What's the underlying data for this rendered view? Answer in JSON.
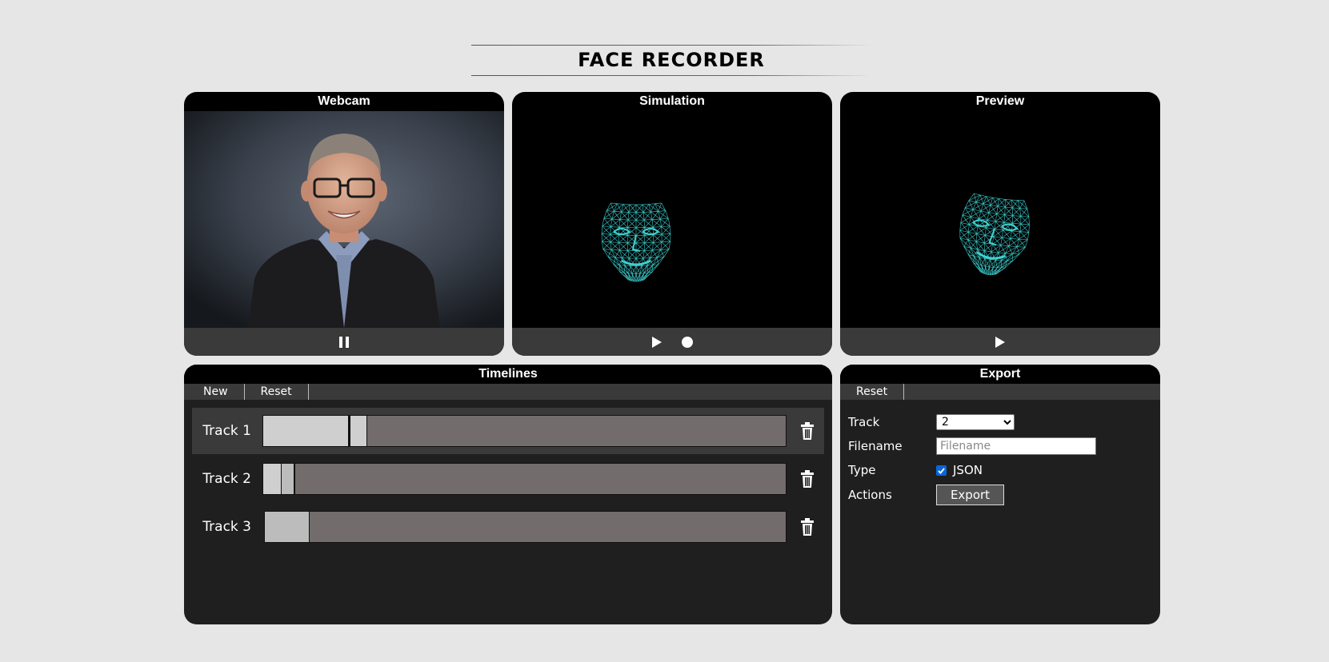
{
  "app": {
    "title": "FACE RECORDER"
  },
  "panels": {
    "webcam": {
      "title": "Webcam"
    },
    "simulation": {
      "title": "Simulation"
    },
    "preview": {
      "title": "Preview"
    }
  },
  "icons": {
    "pause": "pause-icon",
    "play": "play-icon",
    "record": "record-icon",
    "trash": "trash-icon"
  },
  "timelines": {
    "title": "Timelines",
    "toolbar": {
      "new_label": "New",
      "reset_label": "Reset"
    },
    "tracks": [
      {
        "label": "Track 1",
        "selected": true
      },
      {
        "label": "Track 2",
        "selected": false
      },
      {
        "label": "Track 3",
        "selected": false
      }
    ]
  },
  "export": {
    "title": "Export",
    "toolbar": {
      "reset_label": "Reset"
    },
    "track_label": "Track",
    "track_value": "2",
    "filename_label": "Filename",
    "filename_placeholder": "Filename",
    "type_label": "Type",
    "type_option": "JSON",
    "type_checked": true,
    "actions_label": "Actions",
    "export_button": "Export"
  },
  "colors": {
    "background": "#e6e6e6",
    "panel": "#000000",
    "footer": "#3a3a3a",
    "mesh": "#3fd0d0",
    "track_bar": "#736c6c",
    "checkbox": "#0a66d8"
  }
}
